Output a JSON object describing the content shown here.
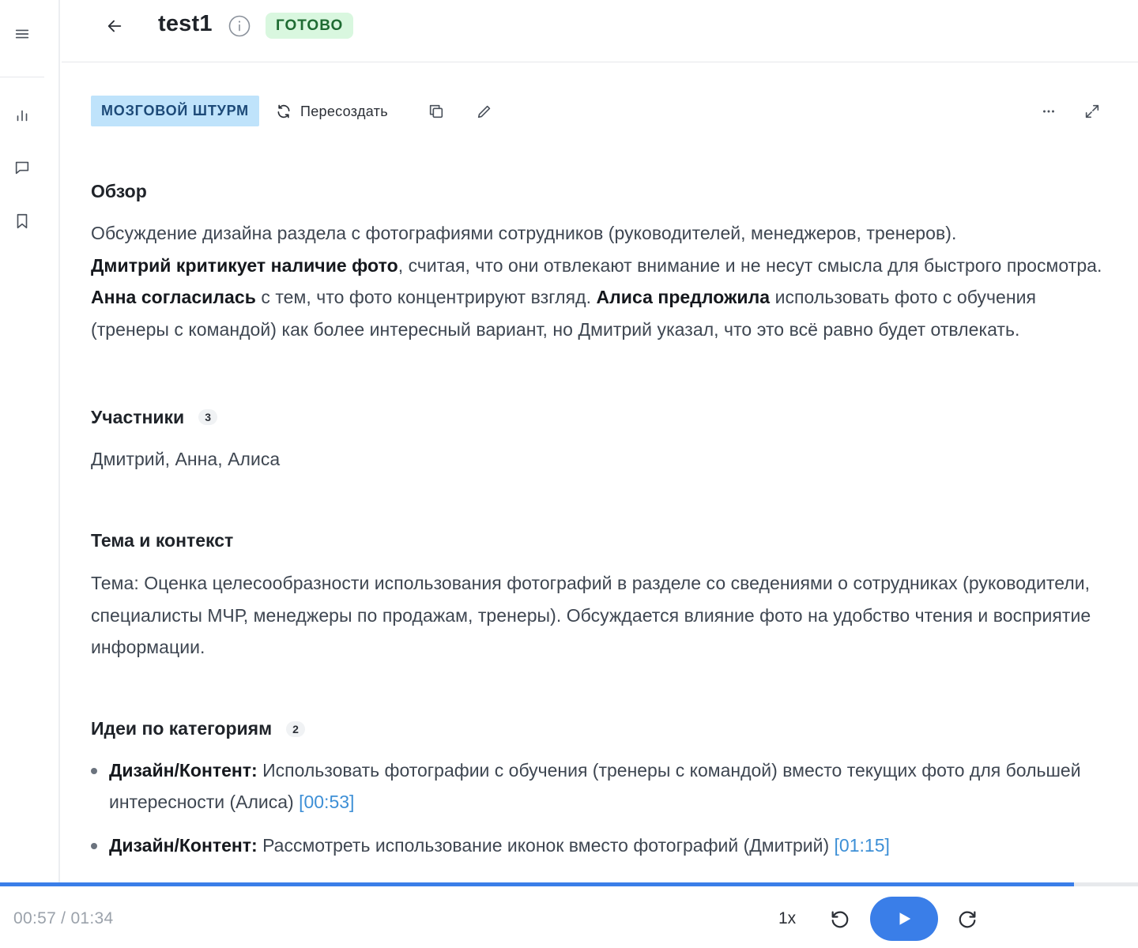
{
  "header": {
    "title": "test1",
    "status": "ГОТОВО",
    "back_icon": "arrow-left-icon",
    "info_icon": "info-icon"
  },
  "sidebar": {
    "items": [
      {
        "icon": "menu-icon"
      },
      {
        "icon": "chart-icon"
      },
      {
        "icon": "chat-icon"
      },
      {
        "icon": "bookmark-icon"
      }
    ]
  },
  "toolbar": {
    "type_label": "МОЗГОВОЙ ШТУРМ",
    "regenerate_label": "Пересоздать",
    "copy_icon": "copy-icon",
    "edit_icon": "pencil-icon",
    "more_icon": "more-horizontal-icon",
    "expand_icon": "expand-icon"
  },
  "overview": {
    "title": "Обзор",
    "p1": "Обсуждение дизайна раздела с фотографиями сотрудников (руководителей, менеджеров, тренеров).",
    "b1": "Дмитрий критикует наличие фото",
    "p2": ", считая, что они отвлекают внимание и не несут смысла для быстрого просмотра.",
    "b2": "Анна согласилась",
    "p3": " с тем, что фото концентрируют взгляд.",
    "b3": "Алиса предложила",
    "p4": " использовать фото с обучения (тренеры с командой) как более интересный вариант, но Дмитрий указал, что это всё равно будет отвлекать."
  },
  "participants": {
    "title": "Участники",
    "count": "3",
    "names": "Дмитрий, Анна, Алиса"
  },
  "topic": {
    "title": "Тема и контекст",
    "text": "Тема: Оценка целесообразности использования фотографий в разделе со сведениями о сотрудниках (руководители, специалисты МЧР, менеджеры по продажам, тренеры). Обсуждается влияние фото на удобство чтения и восприятие информации."
  },
  "ideas": {
    "title": "Идеи по категориям",
    "count": "2",
    "items": [
      {
        "category": "Дизайн/Контент:",
        "text": " Использовать фотографии с обучения (тренеры с командой) вместо текущих фото для большей интересности (Алиса) ",
        "timestamp": "[00:53]"
      },
      {
        "category": "Дизайн/Контент:",
        "text": " Рассмотреть использование иконок вместо фотографий (Дмитрий) ",
        "timestamp": "[01:15]"
      }
    ]
  },
  "player": {
    "time": "00:57 / 01:34",
    "progress": 0.944,
    "speed": "1x",
    "rewind_icon": "rewind-icon",
    "play_icon": "play-icon",
    "forward_icon": "forward-icon"
  },
  "colors": {
    "accent": "#3a7ee8",
    "status_bg": "#d9f7df",
    "type_bg": "#bfe3fb",
    "timestamp": "#3d8fd6"
  }
}
